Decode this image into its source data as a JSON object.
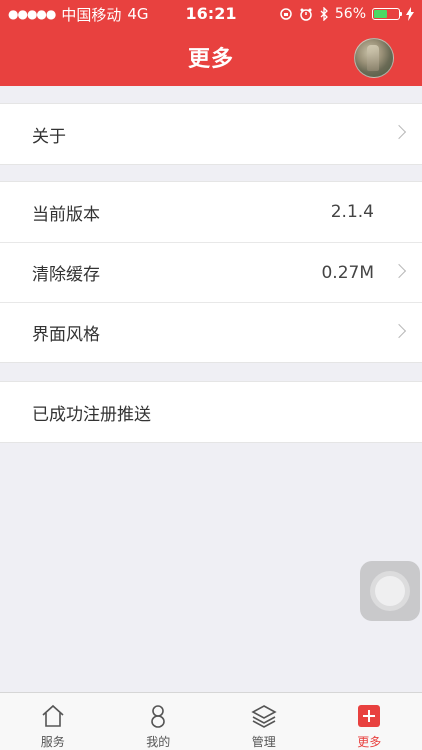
{
  "status_bar": {
    "carrier": "中国移动",
    "network": "4G",
    "time": "16:21",
    "battery_percent": "56%",
    "battery_level": 0.56
  },
  "nav": {
    "title": "更多"
  },
  "groups": {
    "about": {
      "label": "关于"
    },
    "version": {
      "label": "当前版本",
      "value": "2.1.4"
    },
    "cache": {
      "label": "清除缓存",
      "value": "0.27M"
    },
    "theme": {
      "label": "界面风格"
    },
    "push": {
      "label": "已成功注册推送"
    }
  },
  "tabs": [
    {
      "label": "服务",
      "icon": "home-icon"
    },
    {
      "label": "我的",
      "icon": "person-icon"
    },
    {
      "label": "管理",
      "icon": "layers-icon"
    },
    {
      "label": "更多",
      "icon": "plus-icon",
      "active": true
    }
  ],
  "colors": {
    "accent": "#e8413f",
    "battery": "#4cd964"
  }
}
